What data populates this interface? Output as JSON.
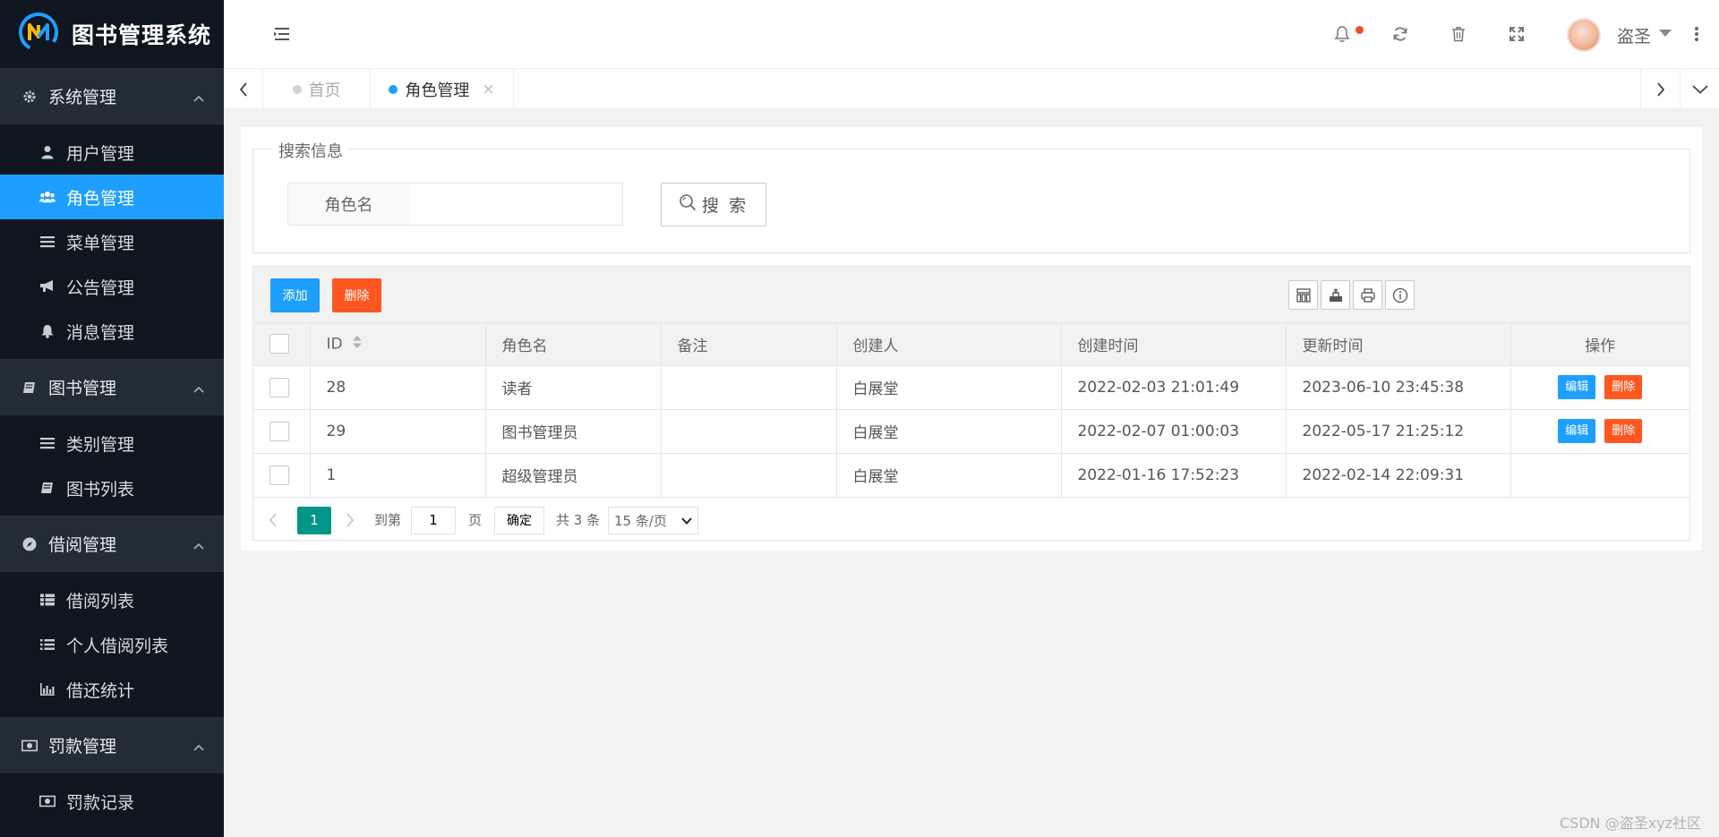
{
  "app": {
    "title": "图书管理系统"
  },
  "sidebar": {
    "groups": [
      {
        "label": "系统管理",
        "icon": "gear-icon",
        "items": [
          {
            "label": "用户管理",
            "icon": "user-icon"
          },
          {
            "label": "角色管理",
            "icon": "users-icon",
            "active": true
          },
          {
            "label": "菜单管理",
            "icon": "list-icon"
          },
          {
            "label": "公告管理",
            "icon": "bullhorn-icon"
          },
          {
            "label": "消息管理",
            "icon": "bell-icon"
          }
        ]
      },
      {
        "label": "图书管理",
        "icon": "book-icon",
        "items": [
          {
            "label": "类别管理",
            "icon": "list-icon"
          },
          {
            "label": "图书列表",
            "icon": "book-icon"
          }
        ]
      },
      {
        "label": "借阅管理",
        "icon": "compass-icon",
        "items": [
          {
            "label": "借阅列表",
            "icon": "table-list-icon"
          },
          {
            "label": "个人借阅列表",
            "icon": "bullet-list-icon"
          },
          {
            "label": "借还统计",
            "icon": "bar-chart-icon"
          }
        ]
      },
      {
        "label": "罚款管理",
        "icon": "money-icon",
        "items": [
          {
            "label": "罚款记录",
            "icon": "money-icon"
          }
        ]
      }
    ]
  },
  "header": {
    "username": "盗圣",
    "icons": [
      "menu-toggle-icon",
      "bell-icon",
      "refresh-icon",
      "trash-icon",
      "fullscreen-icon",
      "more-icon"
    ],
    "colors": {
      "notify_dot": "#f04e23"
    }
  },
  "tabs": [
    {
      "label": "首页",
      "active": false
    },
    {
      "label": "角色管理",
      "active": true,
      "closable": true
    }
  ],
  "search": {
    "legend": "搜索信息",
    "field_label": "角色名",
    "field_value": "",
    "button_label": "搜 索"
  },
  "toolbar": {
    "add_label": "添加",
    "delete_label": "删除"
  },
  "table": {
    "columns": [
      "ID",
      "角色名",
      "备注",
      "创建人",
      "创建时间",
      "更新时间",
      "操作"
    ],
    "rows": [
      {
        "id": "28",
        "name": "读者",
        "remark": "",
        "creator": "白展堂",
        "created": "2022-02-03 21:01:49",
        "updated": "2023-06-10 23:45:38",
        "actions": true
      },
      {
        "id": "29",
        "name": "图书管理员",
        "remark": "",
        "creator": "白展堂",
        "created": "2022-02-07 01:00:03",
        "updated": "2022-05-17 21:25:12",
        "actions": true
      },
      {
        "id": "1",
        "name": "超级管理员",
        "remark": "",
        "creator": "白展堂",
        "created": "2022-01-16 17:52:23",
        "updated": "2022-02-14 22:09:31",
        "actions": false
      }
    ],
    "edit_label": "编辑",
    "remove_label": "删除"
  },
  "pagination": {
    "current_page": "1",
    "goto_label": "到第",
    "goto_value": "1",
    "page_unit": "页",
    "confirm_label": "确定",
    "total_label": "共 3 条",
    "page_size": "15 条/页"
  },
  "watermark": "CSDN @盗圣xyz社区",
  "colors": {
    "sidebar_bg": "#0f161f",
    "sidebar_group_bg": "#222c37",
    "accent_blue": "#1e9fff",
    "danger": "#ff5722",
    "pager_active": "#009688"
  }
}
